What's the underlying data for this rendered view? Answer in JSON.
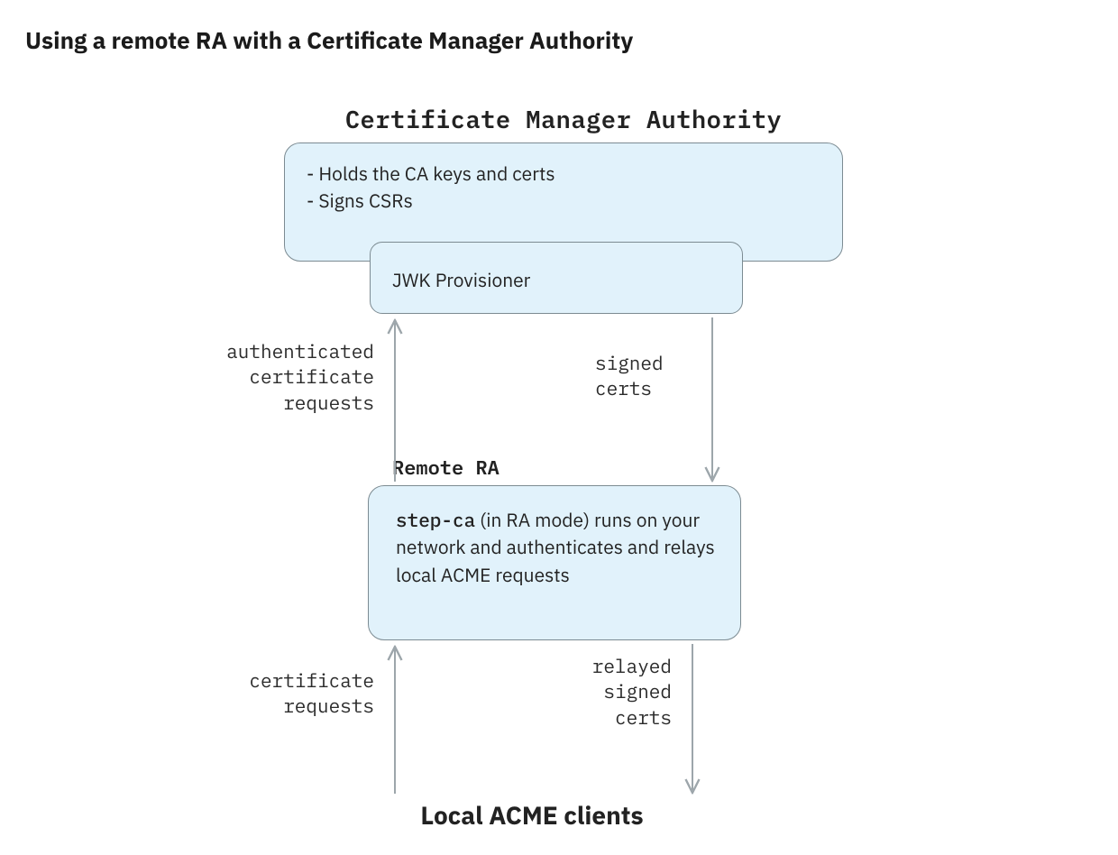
{
  "title": "Using a remote RA with a Certificate Manager Authority",
  "headers": {
    "cma": "Certificate Manager Authority",
    "ra": "Remote RA",
    "clients": "Local ACME clients"
  },
  "cma_body_line1": "- Holds the CA keys and certs",
  "cma_body_line2": "- Signs CSRs",
  "jwk_label": "JWK Provisioner",
  "ra_body": {
    "code": "step-ca",
    "tail": " (in RA mode) runs on your network and authenticates and relays local ACME requests"
  },
  "labels": {
    "auth_req_l1": "authenticated",
    "auth_req_l2": "certificate",
    "auth_req_l3": "requests",
    "signed_l1": "signed",
    "signed_l2": "certs",
    "cert_req_l1": "certificate",
    "cert_req_l2": "requests",
    "relayed_l1": "relayed",
    "relayed_l2": "signed",
    "relayed_l3": "certs"
  }
}
